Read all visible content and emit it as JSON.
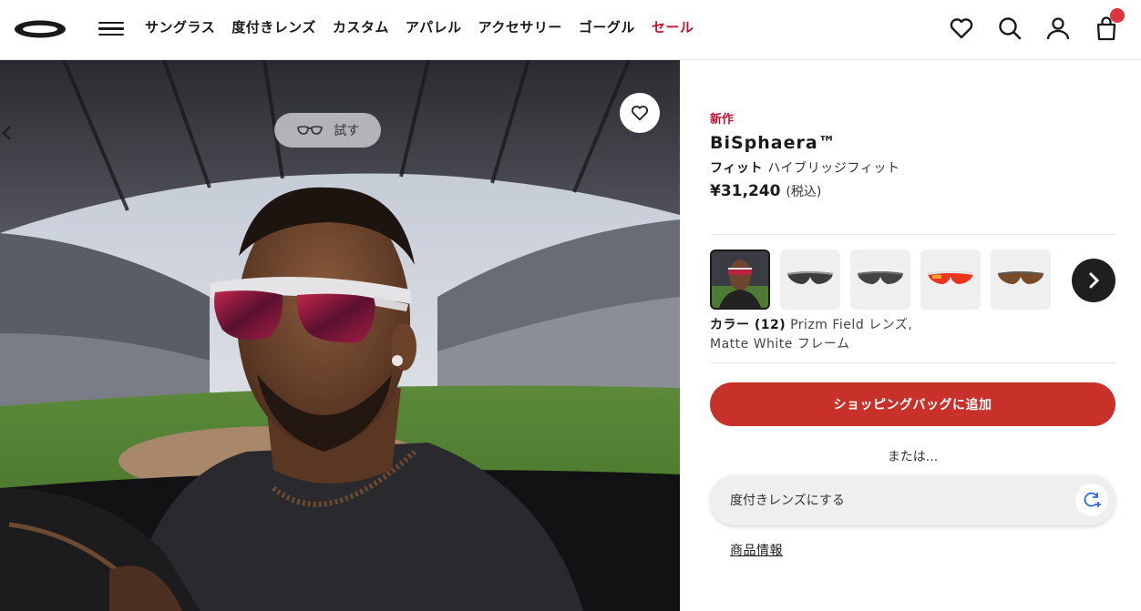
{
  "header": {
    "nav": [
      {
        "label": "サングラス"
      },
      {
        "label": "度付きレンズ"
      },
      {
        "label": "カスタム"
      },
      {
        "label": "アパレル"
      },
      {
        "label": "アクセサリー"
      },
      {
        "label": "ゴーグル"
      },
      {
        "label": "セール",
        "highlight": "#c8102e"
      }
    ],
    "icons": [
      "menu-icon",
      "heart-icon",
      "search-icon",
      "account-icon",
      "cart-icon"
    ]
  },
  "hero": {
    "try_label": "試す"
  },
  "product": {
    "badge": "新作",
    "name": "BiSphaera™",
    "fit_label": "フィット",
    "fit_value": "ハイブリッジフィット",
    "price": "¥31,240",
    "tax": "(税込)",
    "color_label": "カラー (12)",
    "color_value_line1": "Prizm Field レンズ,",
    "color_value_line2": "Matte White フレーム",
    "add_to_bag": "ショッピングバッグに追加",
    "or_text": "または...",
    "rx_option": "度付きレンズにする",
    "product_info": "商品情報"
  },
  "swatch_lenses": [
    {
      "lens": "#3b1f2a",
      "frame": "#d9d9d9",
      "selected": true
    },
    {
      "lens": "#3d3d3d",
      "frame": "#9a9a9a"
    },
    {
      "lens": "#444444",
      "frame": "#6d6d6d"
    },
    {
      "lens": "#e8351c",
      "frame": "#e6e6e6"
    },
    {
      "lens": "#7a4b2a",
      "frame": "#5a5a5a"
    }
  ],
  "colors": {
    "accent": "#c8302a",
    "sale": "#c8102e"
  }
}
